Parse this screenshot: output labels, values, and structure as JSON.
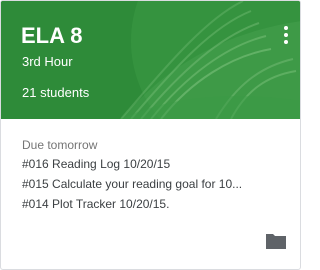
{
  "class": {
    "name": "ELA 8",
    "section": "3rd Hour",
    "students": "21 students"
  },
  "due": {
    "label": "Due tomorrow",
    "assignments": [
      "#016 Reading Log 10/20/15",
      "#015 Calculate your reading goal for 10...",
      "#014 Plot Tracker 10/20/15."
    ]
  },
  "icons": {
    "menu": "more-vert-icon",
    "folder": "folder-icon"
  },
  "colors": {
    "banner": "#2f8f3b",
    "banner_text": "#ffffff",
    "muted_text": "#757575",
    "body_text": "#3c4043"
  }
}
